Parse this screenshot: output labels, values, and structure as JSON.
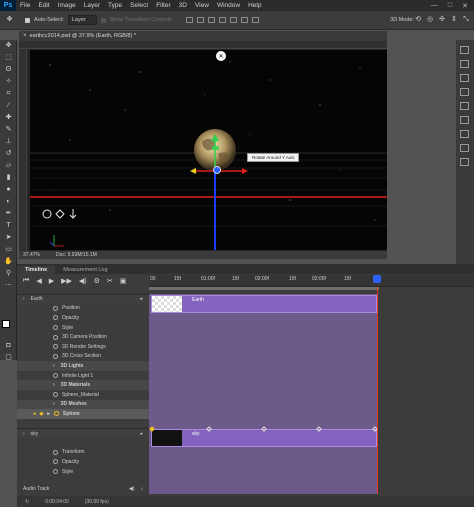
{
  "app": {
    "logo": "Ps"
  },
  "menu": [
    "File",
    "Edit",
    "Image",
    "Layer",
    "Type",
    "Select",
    "Filter",
    "3D",
    "View",
    "Window",
    "Help"
  ],
  "window_controls": [
    "—",
    "□",
    "✕"
  ],
  "options_bar": {
    "auto_select_label": "Auto-Select:",
    "auto_select_value": "Layer",
    "transform_controls_label": "Show Transform Controls",
    "mode_label": "3D Mode:"
  },
  "tools": [
    "move-icon",
    "marquee-icon",
    "lasso-icon",
    "magic-wand-icon",
    "crop-icon",
    "eyedropper-icon",
    "healing-icon",
    "brush-icon",
    "stamp-icon",
    "history-brush-icon",
    "eraser-icon",
    "gradient-icon",
    "blur-icon",
    "dodge-icon",
    "pen-icon",
    "type-icon",
    "path-select-icon",
    "shape-icon",
    "hand-icon",
    "zoom-icon"
  ],
  "document": {
    "tab_title": "earthcc2014.psd @ 37.9% (Earth, RGB/8) *",
    "zoom": "37.47%",
    "doc_info": "Doc: 5.93M/15.1M",
    "tooltip": "Rotate Around Y Axis"
  },
  "timeline": {
    "tabs": [
      "Timeline",
      "Measurement Log"
    ],
    "ruler_labels": [
      "00",
      "15f",
      "01:00f",
      "15f",
      "02:00f",
      "15f",
      "03:00f",
      "15f"
    ],
    "rows": [
      {
        "label": "Earth",
        "kind": "layer-head"
      },
      {
        "label": "Position",
        "kind": "prop"
      },
      {
        "label": "Opacity",
        "kind": "prop"
      },
      {
        "label": "Style",
        "kind": "prop"
      },
      {
        "label": "3D Camera Position",
        "kind": "prop"
      },
      {
        "label": "3D Render Settings",
        "kind": "prop"
      },
      {
        "label": "3D Cross Section",
        "kind": "prop"
      },
      {
        "label": "3D Lights",
        "kind": "group"
      },
      {
        "label": "Infinite Light 1",
        "kind": "prop"
      },
      {
        "label": "3D Materials",
        "kind": "group"
      },
      {
        "label": "Sphere_Material",
        "kind": "prop"
      },
      {
        "label": "3D Meshes",
        "kind": "group"
      },
      {
        "label": "Sphere",
        "kind": "selected"
      },
      {
        "label": "",
        "kind": "blank"
      },
      {
        "label": "sky",
        "kind": "layer-head"
      },
      {
        "label": "Transform",
        "kind": "prop"
      },
      {
        "label": "Opacity",
        "kind": "prop"
      },
      {
        "label": "Style",
        "kind": "prop"
      },
      {
        "label": "",
        "kind": "blank"
      },
      {
        "label": "Audio Track",
        "kind": "audio"
      }
    ],
    "clip_labels": {
      "earth": "Earth",
      "sky": "sky"
    },
    "timecode": "0:00:04:00",
    "fps": "(30.00 fps)"
  }
}
